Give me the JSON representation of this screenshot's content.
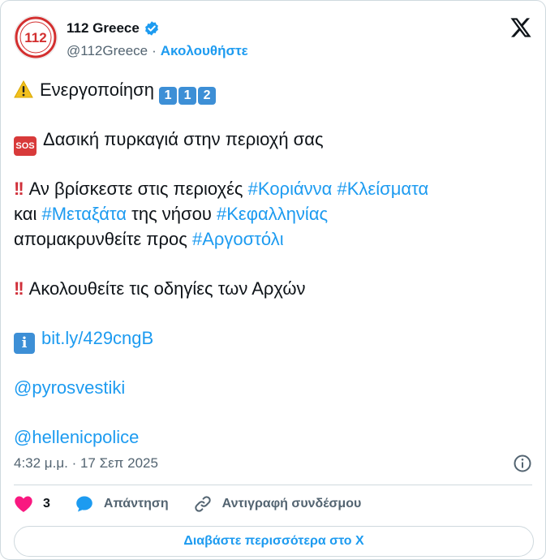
{
  "header": {
    "display_name": "112 Greece",
    "handle": "@112Greece",
    "separator": "·",
    "follow_label": "Ακολουθήστε",
    "avatar_text": "112"
  },
  "tweet": {
    "activation_text": "Ενεργοποίηση",
    "activation_digits": [
      "1",
      "1",
      "2"
    ],
    "sos_badge": "SOS",
    "fire_text": "Δασική πυρκαγιά στην περιοχή σας",
    "warning_line1_prefix": "Αν βρίσκεστε στις περιοχές",
    "hashtags_line1": [
      "#Κοριάννα",
      "#Κλείσματα"
    ],
    "line2_prefix": "και",
    "hashtag_line2_a": "#Μεταξάτα",
    "line2_middle": "της νήσου",
    "hashtag_line2_b": "#Κεφαλληνίας",
    "line3_prefix": "απομακρυνθείτε προς",
    "hashtag_line3": "#Αργοστόλι",
    "instructions_text": "Ακολουθείτε τις οδηγίες των Αρχών",
    "info_badge": "i",
    "link": "bit.ly/429cngB",
    "mention_1": "@pyrosvestiki",
    "mention_2": "@hellenicpolice"
  },
  "meta": {
    "timestamp": "4:32 μ.μ. · 17 Σεπ 2025"
  },
  "actions": {
    "like_count": "3",
    "reply_label": "Απάντηση",
    "copy_link_label": "Αντιγραφή συνδέσμου"
  },
  "read_more_label": "Διαβάστε περισσότερα στο X",
  "icons": {
    "verified": "verified-badge-icon",
    "x_logo": "x-logo-icon",
    "warning": "warning-icon",
    "double_exclamation": "double-exclamation-icon",
    "info": "info-circle-icon",
    "heart": "heart-icon",
    "reply": "reply-bubble-icon",
    "link": "link-icon"
  },
  "colors": {
    "accent": "#1d9bf0",
    "text": "#0f1419",
    "muted": "#536471",
    "like": "#f91880",
    "alert_red": "#d0303a",
    "border": "#cfd9de"
  }
}
